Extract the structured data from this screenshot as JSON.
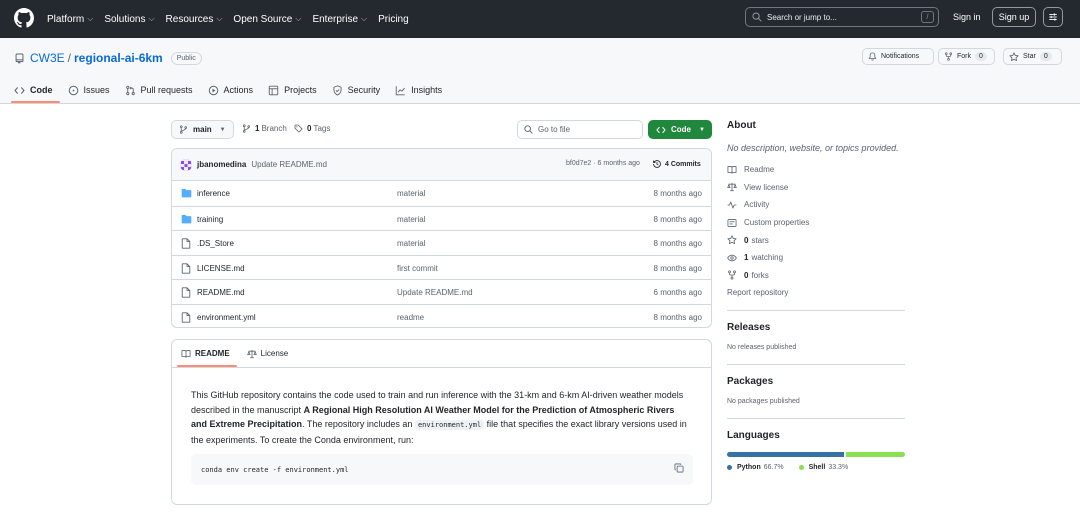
{
  "header": {
    "nav": [
      "Platform",
      "Solutions",
      "Resources",
      "Open Source",
      "Enterprise",
      "Pricing"
    ],
    "search_placeholder": "Search or jump to...",
    "search_key": "/",
    "signin": "Sign in",
    "signup": "Sign up"
  },
  "repo": {
    "owner": "CW3E",
    "separator": "/",
    "name": "regional-ai-6km",
    "visibility": "Public",
    "notifications_label": "Notifications",
    "fork_label": "Fork",
    "fork_count": "0",
    "star_label": "Star",
    "star_count": "0"
  },
  "tabs": [
    {
      "label": "Code",
      "icon": "code-icon"
    },
    {
      "label": "Issues",
      "icon": "issue-icon"
    },
    {
      "label": "Pull requests",
      "icon": "pull-request-icon"
    },
    {
      "label": "Actions",
      "icon": "play-icon"
    },
    {
      "label": "Projects",
      "icon": "table-icon"
    },
    {
      "label": "Security",
      "icon": "shield-icon"
    },
    {
      "label": "Insights",
      "icon": "graph-icon"
    }
  ],
  "controls": {
    "branch": "main",
    "branch_count": "1",
    "branch_label": "Branch",
    "tag_count": "0",
    "tag_label": "Tags",
    "goto_placeholder": "Go to file",
    "code_button": "Code"
  },
  "commit": {
    "author": "jbanomedina",
    "message": "Update README.md",
    "sha_time": "bf0d7e2 · 6 months ago",
    "commits": "4 Commits"
  },
  "files": [
    {
      "name": "inference",
      "type": "folder",
      "message": "material",
      "age": "8 months ago"
    },
    {
      "name": "training",
      "type": "folder",
      "message": "material",
      "age": "8 months ago"
    },
    {
      "name": ".DS_Store",
      "type": "file",
      "message": "material",
      "age": "8 months ago"
    },
    {
      "name": "LICENSE.md",
      "type": "file",
      "message": "first commit",
      "age": "8 months ago"
    },
    {
      "name": "README.md",
      "type": "file",
      "message": "Update README.md",
      "age": "6 months ago"
    },
    {
      "name": "environment.yml",
      "type": "file",
      "message": "readme",
      "age": "8 months ago"
    }
  ],
  "readme": {
    "tab_readme": "README",
    "tab_license": "License",
    "p1": "This GitHub repository contains the code used to train and run inference with the 31-km and 6-km AI-driven weather models described in the manuscript ",
    "p1_bold": "A Regional High Resolution AI Weather Model for the Prediction of Atmospheric Rivers and Extreme Precipitation",
    "p1_mid": ". The repository includes an ",
    "p1_code": "environment.yml",
    "p1_end": " file that specifies the exact library versions used in the experiments. To create the Conda environment, run:",
    "command": "conda env create -f environment.yml"
  },
  "sidebar": {
    "about_title": "About",
    "description": "No description, website, or topics provided.",
    "readme": "Readme",
    "license": "View license",
    "activity": "Activity",
    "custom_properties": "Custom properties",
    "stars_count": "0",
    "stars_label": "stars",
    "watching_count": "1",
    "watching_label": "watching",
    "forks_count": "0",
    "forks_label": "forks",
    "report": "Report repository",
    "releases_title": "Releases",
    "releases_empty": "No releases published",
    "packages_title": "Packages",
    "packages_empty": "No packages published",
    "languages_title": "Languages",
    "languages": [
      {
        "name": "Python",
        "percent": "66.7%",
        "share": 66.7,
        "color": "#3572A5"
      },
      {
        "name": "Shell",
        "percent": "33.3%",
        "share": 33.3,
        "color": "#89e051"
      }
    ]
  },
  "colors": {
    "header_bg": "#24292f",
    "link": "#0969da",
    "primary_button": "#1f883d",
    "tab_underline": "#fd8c73",
    "folder": "#54aeff"
  }
}
